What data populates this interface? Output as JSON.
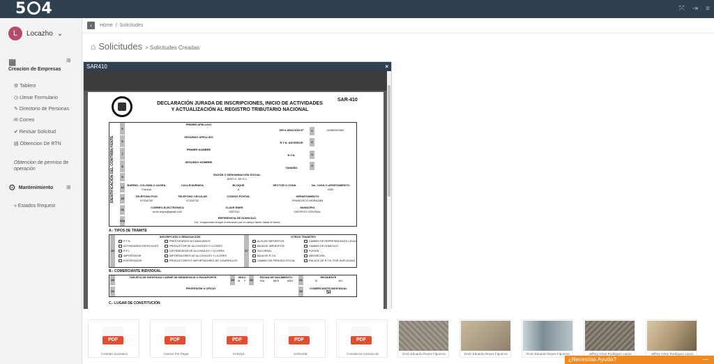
{
  "topbar": {
    "logo_left": "5",
    "logo_right": "4",
    "icons": [
      "expand-icon",
      "logout-icon",
      "menu-icon"
    ]
  },
  "user": {
    "initial": "L",
    "name": "Locazho"
  },
  "sidebar": {
    "section1_title": "Creacion de Empresas",
    "items": [
      {
        "label": "Tablero",
        "icon": "palette-icon"
      },
      {
        "label": "Llenar Formulario",
        "icon": "clock-icon"
      },
      {
        "label": "Directorio de Personas",
        "icon": "edit-icon"
      },
      {
        "label": "Correo",
        "icon": "envelope-icon"
      },
      {
        "label": "Revisar Solicitud",
        "icon": "check-icon"
      },
      {
        "label": "Obtencion De RTN",
        "icon": "file-icon"
      },
      {
        "label": "Obtencion de permiso de operación",
        "icon": ""
      }
    ],
    "section2_title": "Mantenimiento",
    "items2": [
      {
        "label": "Estados Request",
        "icon": "chevron-right-icon"
      }
    ]
  },
  "breadcrumb": {
    "home": "Home",
    "sep": "/",
    "current": "Solicitudes"
  },
  "page": {
    "title": "Solicitudes",
    "subtitle": "> Solicitudes Creadas"
  },
  "modal": {
    "title": "SAR410",
    "close": "×",
    "doc": {
      "title_line1": "DECLARACIÓN JURADA DE INSCRIPCIONES, INICIO DE ACTIVIDADES",
      "title_line2": "Y ACTUALIZACIÓN AL REGISTRO TRIBUTARIO NACIONAL",
      "code": "SAR-410",
      "side_label": "IDENTIFICACIÓN DEL CONTRIBUYENTE",
      "labels": {
        "primer_apellido": "PRIMER APELLIDO",
        "segundo_apellido": "SEGUNDO APELLIDO",
        "primer_nombre": "PRIMER NOMBRE",
        "segundo_nombre": "SEGUNDO NOMBRE",
        "declaracion": "DECLARACIÓN Nº",
        "rtn_anterior": "R.T.N. ANTERIOR",
        "rtn": "R.T.N.",
        "tamano": "TAMAÑO",
        "razon_social": "RAZÓN O DENOMINACIÓN SOCIAL",
        "barrio": "BARRIO, COLONIA O ALDEA",
        "calle": "CALLE/AVENIDA",
        "bloque": "BLOQUE",
        "sector": "SECTOR O ZONA",
        "casa": "No. CASA O APARTAMENTO",
        "tel_fijo": "TELÉFONO FIJO",
        "tel_cel": "TELÉFONO CELULAR",
        "postal": "CÓDIGO POSTAL",
        "depto": "DEPARTAMENTO",
        "correo": "CORREO ELECTRÓNICO",
        "clave": "CLAVE ENEE",
        "municipio": "MUNICIPIO",
        "referencia": "REFERENCIA DE DOMICILIO",
        "tipos_tramite": "A.- TIPOS DE TRÁMITE",
        "inscripcion": "INSCRIPCIÓN O RENOVACIÓN",
        "otros": "OTROS TRAMITES",
        "comerciante": "B.- COMERCIANTE INDIVIDUAL",
        "tarjeta": "TARJETA DE IDENTIDAD CARNÉ DE RESIDENCIA O PASAPORTE",
        "sexo": "SEXO",
        "fecha_nac": "FECHA DE NACIMIENTO",
        "residente": "RESIDENTE",
        "profesion": "PROFESIÓN U OFICIO",
        "comerciante_ind": "COMERCIANTE INDIVIDUAL",
        "lugar": "C.- LUGAR DE CONSTITUCIÓN"
      },
      "values": {
        "declaracion": "410800X0082",
        "razon_social": "JERO S. DE R.L.",
        "barrio": "Colonia",
        "bloque": "A",
        "casa": "4431",
        "tel_fijo": "97318732",
        "tel_cel": "97318732",
        "depto": "FRANCISCO MORAZÁN",
        "correo": "emin.reyes@gmail.com",
        "clave": "0007511",
        "municipio": "DISTRITO CENTRAL",
        "referencia": "Col. Guaymuras bloque A entrando por el campo lanch hasta el fondo",
        "comerciante_si": "SÍ",
        "mark": "X"
      },
      "nums": [
        "5",
        "6",
        "7",
        "8",
        "9",
        "10",
        "11",
        "12",
        "13",
        "14",
        "15",
        "16",
        "17",
        "18",
        "19",
        "20",
        "21",
        "22",
        "23",
        "22A",
        "25",
        "27",
        "28",
        "29",
        "30",
        "31",
        "32",
        "33",
        "1",
        "2",
        "3",
        "4"
      ],
      "checks_left": [
        "R.T.N.",
        "ACTIVIDADES ESPECIALES",
        "R.F.I.",
        "IMPORTADOR",
        "EXPORTADOR"
      ],
      "checks_mid": [
        "PRESTATARIOS NO BANCARIOS",
        "PRODUCTOR DE ALCOHOLES Y LICORES",
        "DISTRIBUIDOR DE ALCOHOLES Y LICORES",
        "IMPORTADORES DE ALCOHOLES Y LICORES",
        "PRODUCTORES E IMPORTADORES DE CIGARRILLOS"
      ],
      "checks_right1": [
        "ALTA DE IMPUESTOS",
        "BAJA DE IMPUESTOS",
        "SUCURSAL",
        "BAJA DE R.T.N.",
        "CAMBIO DE PERIODO FISCAL"
      ],
      "checks_right2": [
        "CAMBIO DE REPRESENTANTE LEGAL",
        "CAMBIO DE DOMICILIO",
        "FUSIÓN",
        "ABSORCIÓN",
        "ENLACE DE R.T.N. POR DUPLICIDAD"
      ],
      "sub_dmy": [
        "M",
        "F",
        "DÍA",
        "MES",
        "AÑO",
        "SI",
        "NO"
      ]
    }
  },
  "attachments": [
    {
      "type": "pdf",
      "badge": "PDF",
      "caption": "Contrato Societario"
    },
    {
      "type": "pdf",
      "badge": "PDF",
      "caption": "Gastos Por Pagar"
    },
    {
      "type": "pdf",
      "badge": "PDF",
      "caption": "SAR410"
    },
    {
      "type": "pdf",
      "badge": "PDF",
      "caption": "SAR410B"
    },
    {
      "type": "pdf",
      "badge": "PDF",
      "caption": "Constancia Camara de"
    },
    {
      "type": "photo",
      "caption": "Emin Eduardo Reyes Figueroa",
      "tone": "#8a8478"
    },
    {
      "type": "photo",
      "caption": "Emin Eduardo Reyes Figueroa",
      "tone": "#a89a82"
    },
    {
      "type": "photo",
      "caption": "Emin Eduardo Reyes Figueroa",
      "tone": "#7d8c95"
    },
    {
      "type": "photo",
      "caption": "Jeffrey Omar Rodriguez Lanza",
      "tone": "#716a5e"
    },
    {
      "type": "photo",
      "caption": "Jeffrey Omar Rodriguez Lanza",
      "tone": "#b09a76"
    }
  ],
  "help": {
    "label": "¿Necesitas Ayuda?",
    "minimize": "—"
  }
}
